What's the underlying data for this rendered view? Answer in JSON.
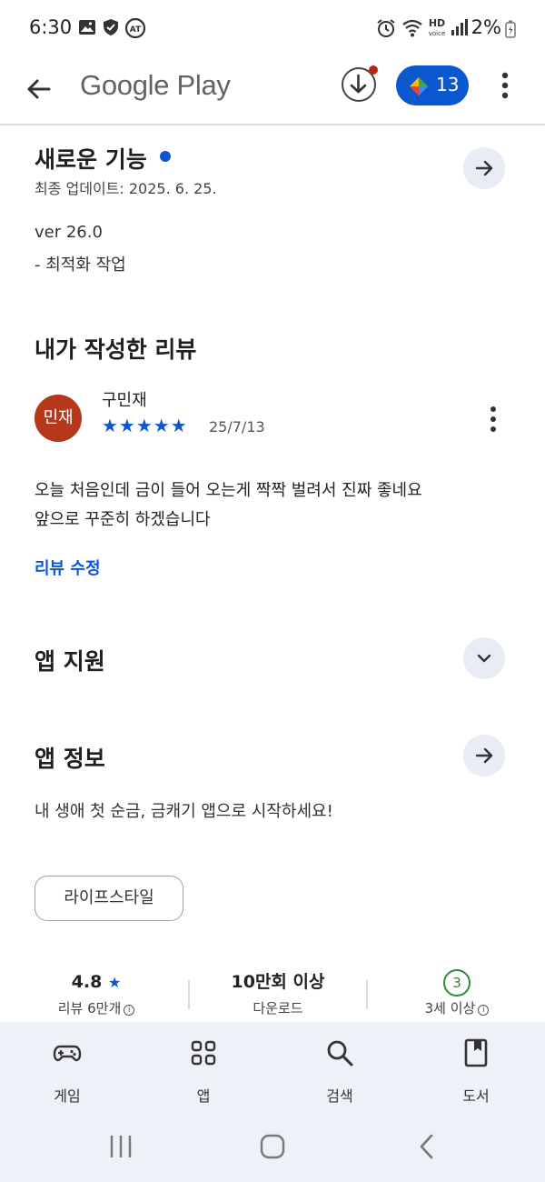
{
  "status_bar": {
    "time": "6:30",
    "battery": "2%",
    "icons": [
      "gallery-icon",
      "shield-icon",
      "app-badge-icon",
      "alarm-icon",
      "wifi-icon",
      "hd-voice-icon",
      "signal-icon",
      "battery-icon"
    ]
  },
  "app_bar": {
    "title": "Google Play",
    "points": "13"
  },
  "whats_new": {
    "title": "새로운 기능",
    "updated": "최종 업데이트: 2025. 6. 25.",
    "version": "ver 26.0",
    "note": "- 최적화 작업"
  },
  "my_review": {
    "title": "내가 작성한 리뷰",
    "avatar_text": "민재",
    "reviewer": "구민재",
    "stars": "★★★★★",
    "rating": 5,
    "date": "25/7/13",
    "body_line1": "오늘 처음인데 금이 들어 오는게 짝짝 벌려서 진짜 좋네요",
    "body_line2": "앞으로 꾸준히 하겠습니다",
    "edit_label": "리뷰 수정"
  },
  "app_support": {
    "title": "앱 지원"
  },
  "app_info": {
    "title": "앱 정보",
    "description": "내 생애 첫 순금, 금캐기 앱으로 시작하세요!",
    "category": "라이프스타일"
  },
  "stats": {
    "rating_value": "4.8",
    "rating_star": "★",
    "rating_label": "리뷰 6만개",
    "downloads_value": "10만회 이상",
    "downloads_label": "다운로드",
    "age_value": "3",
    "age_label": "3세 이상"
  },
  "bottom_nav": {
    "games": "게임",
    "apps": "앱",
    "search": "검색",
    "books": "도서"
  },
  "colors": {
    "accent": "#0b57d0",
    "avatar": "#b5381b",
    "age_badge": "#2e8b36",
    "nav_bg": "#eef1f8"
  }
}
